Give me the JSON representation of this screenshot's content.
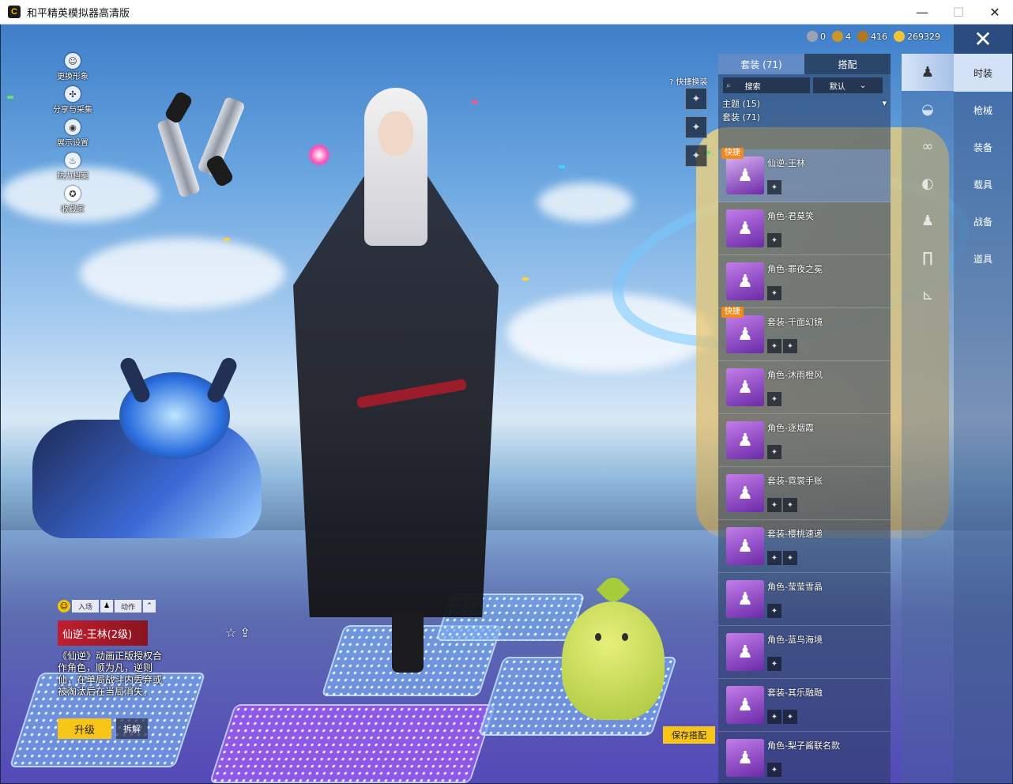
{
  "window": {
    "title": "和平精英模拟器高清版",
    "icon_letter": "C",
    "minimize": "—",
    "maximize": "☐",
    "close": "✕"
  },
  "left_menu": [
    {
      "icon": "user-icon",
      "glyph": "☺",
      "label": "更换形象"
    },
    {
      "icon": "share-icon",
      "glyph": "✣",
      "label": "分享与采集"
    },
    {
      "icon": "eye-icon",
      "glyph": "◉",
      "label": "展示设置"
    },
    {
      "icon": "flame-icon",
      "glyph": "♨",
      "label": "热力档案"
    },
    {
      "icon": "badge-icon",
      "glyph": "✪",
      "label": "收藏家"
    }
  ],
  "currency": [
    {
      "icon": "silver-coin-icon",
      "color": "#9aa4b4",
      "value": "0"
    },
    {
      "icon": "medal-coin-icon",
      "color": "#c9962a",
      "value": "4"
    },
    {
      "icon": "bronze-coin-icon",
      "color": "#b2771e",
      "value": "416"
    },
    {
      "icon": "gold-coin-icon",
      "color": "#f0c23a",
      "value": "269329"
    }
  ],
  "quick_change": {
    "label": "快捷换装",
    "help_glyph": "?",
    "slots": [
      "✦",
      "✦",
      "✦"
    ]
  },
  "panel": {
    "tabs": [
      "套装 (71)",
      "搭配"
    ],
    "search_placeholder": "搜索",
    "sort_label": "默认",
    "theme_label": "主题 (15)",
    "suit_label": "套装 (71)",
    "quick_tag": "快捷",
    "outfits": [
      {
        "name": "仙逆-王林",
        "parts": [
          "✦"
        ],
        "quick": true,
        "selected": true
      },
      {
        "name": "角色-君莫笑",
        "parts": [
          "✦"
        ],
        "quick": false
      },
      {
        "name": "角色-罪夜之冕",
        "parts": [
          "✦"
        ],
        "quick": false
      },
      {
        "name": "套装-千面幻镜",
        "parts": [
          "✦",
          "✦"
        ],
        "quick": true
      },
      {
        "name": "角色-沐雨橙风",
        "parts": [
          "✦"
        ],
        "quick": false
      },
      {
        "name": "角色-逐烟霞",
        "parts": [
          "✦"
        ],
        "quick": false
      },
      {
        "name": "套装-霓裳手账",
        "parts": [
          "✦",
          "✦"
        ],
        "quick": false
      },
      {
        "name": "套装-樱桃速递",
        "parts": [
          "✦",
          "✦"
        ],
        "quick": false
      },
      {
        "name": "角色-莹莹雪晶",
        "parts": [
          "✦"
        ],
        "quick": false
      },
      {
        "name": "角色-蓝鸟海境",
        "parts": [
          "✦"
        ],
        "quick": false
      },
      {
        "name": "套装-其乐融融",
        "parts": [
          "✦",
          "✦"
        ],
        "quick": false
      },
      {
        "name": "角色-梨子酱联名款",
        "parts": [
          "✦"
        ],
        "quick": false
      }
    ]
  },
  "category_icons": [
    {
      "icon": "outfit-icon",
      "glyph": "♟"
    },
    {
      "icon": "hat-icon",
      "glyph": "◒"
    },
    {
      "icon": "goggles-icon",
      "glyph": "∞"
    },
    {
      "icon": "mask-icon",
      "glyph": "◐"
    },
    {
      "icon": "top-icon",
      "glyph": "♟"
    },
    {
      "icon": "pants-icon",
      "glyph": "∏"
    },
    {
      "icon": "shoes-icon",
      "glyph": "⊾"
    }
  ],
  "category_tabs": {
    "close_glyph": "✕",
    "items": [
      "时装",
      "枪械",
      "装备",
      "载具",
      "战备",
      "道具"
    ]
  },
  "item_card": {
    "emote_glyph": "☺",
    "enter_label": "入场",
    "action_label": "动作",
    "action_glyph": "⌃",
    "name": "仙逆-王林(2级)",
    "description": "《仙逆》动画正版授权合作角色，顺为凡，逆则仙，在单局战斗内丢弃或被淘汰后在当局消失。",
    "upgrade_label": "升级",
    "dismantle_label": "拆解",
    "fav_glyph": "☆",
    "share_glyph": "⇪"
  },
  "save_outfit_label": "保存搭配"
}
